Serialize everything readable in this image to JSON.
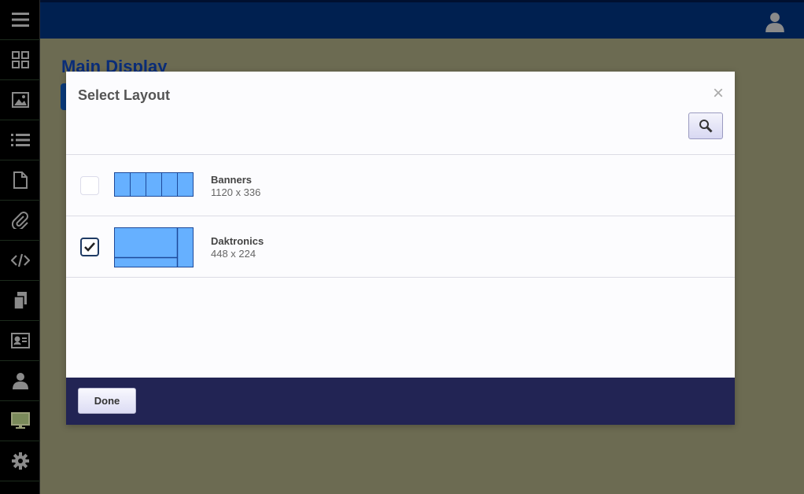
{
  "sidebar": {
    "items": [
      {
        "icon": "menu-icon"
      },
      {
        "icon": "dashboard-grid-icon"
      },
      {
        "icon": "image-icon"
      },
      {
        "icon": "list-icon"
      },
      {
        "icon": "document-icon"
      },
      {
        "icon": "attachment-icon"
      },
      {
        "icon": "code-icon"
      },
      {
        "icon": "copy-icon"
      },
      {
        "icon": "id-card-icon"
      },
      {
        "icon": "user-icon"
      },
      {
        "icon": "monitor-icon"
      },
      {
        "icon": "settings-icon"
      }
    ]
  },
  "topbar": {
    "user_icon": "user-icon"
  },
  "page": {
    "title": "Main Display"
  },
  "modal": {
    "title": "Select Layout",
    "close_label": "×",
    "search_icon": "search-icon",
    "layouts": [
      {
        "name": "Banners",
        "size": "1120 x 336",
        "checked": false
      },
      {
        "name": "Daktronics",
        "size": "448 x 224",
        "checked": true
      }
    ],
    "done_label": "Done"
  },
  "colors": {
    "topbar": "#002050",
    "background": "#6c6b52",
    "footer": "#222454",
    "thumb_fill": "#66b0ff",
    "thumb_stroke": "#1e4a9a"
  }
}
